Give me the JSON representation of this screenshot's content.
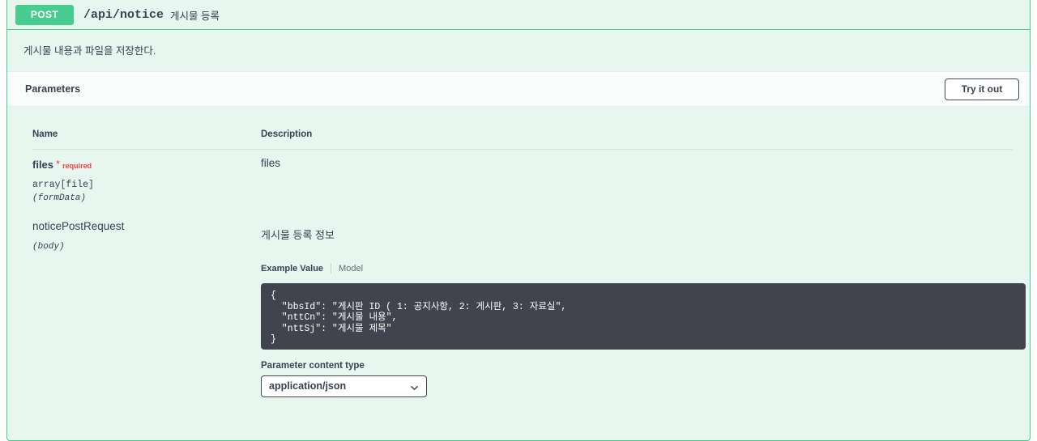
{
  "operation": {
    "method": "POST",
    "method_color": "#49cc90",
    "path": "/api/notice",
    "summary": "게시물 등록",
    "description": "게시물 내용과 파일을 저장한다."
  },
  "parameters_section": {
    "title": "Parameters",
    "try_it_out_label": "Try it out",
    "columns": {
      "name": "Name",
      "description": "Description"
    },
    "rows": [
      {
        "name": "files",
        "required_star": "*",
        "required_label": "required",
        "type": "array[file]",
        "in": "(formData)",
        "description": "files"
      },
      {
        "name": "noticePostRequest",
        "in": "(body)",
        "description": "게시물 등록 정보",
        "tabs": {
          "active": "Example Value",
          "inactive": "Model"
        },
        "example_value": "{\n  \"bbsId\": \"게시판 ID ( 1: 공지사항, 2: 게시판, 3: 자료실\",\n  \"nttCn\": \"게시물 내용\",\n  \"nttSj\": \"게시물 제목\"\n}",
        "content_type": {
          "label": "Parameter content type",
          "selected": "application/json",
          "options": [
            "application/json"
          ]
        }
      }
    ]
  },
  "colors": {
    "method_green": "#49cc90",
    "panel_bg": "#e8f6f0",
    "panel_border": "#49cc90",
    "code_bg": "#41444e",
    "required_red": "#f93e3e",
    "text": "#3b4151"
  }
}
